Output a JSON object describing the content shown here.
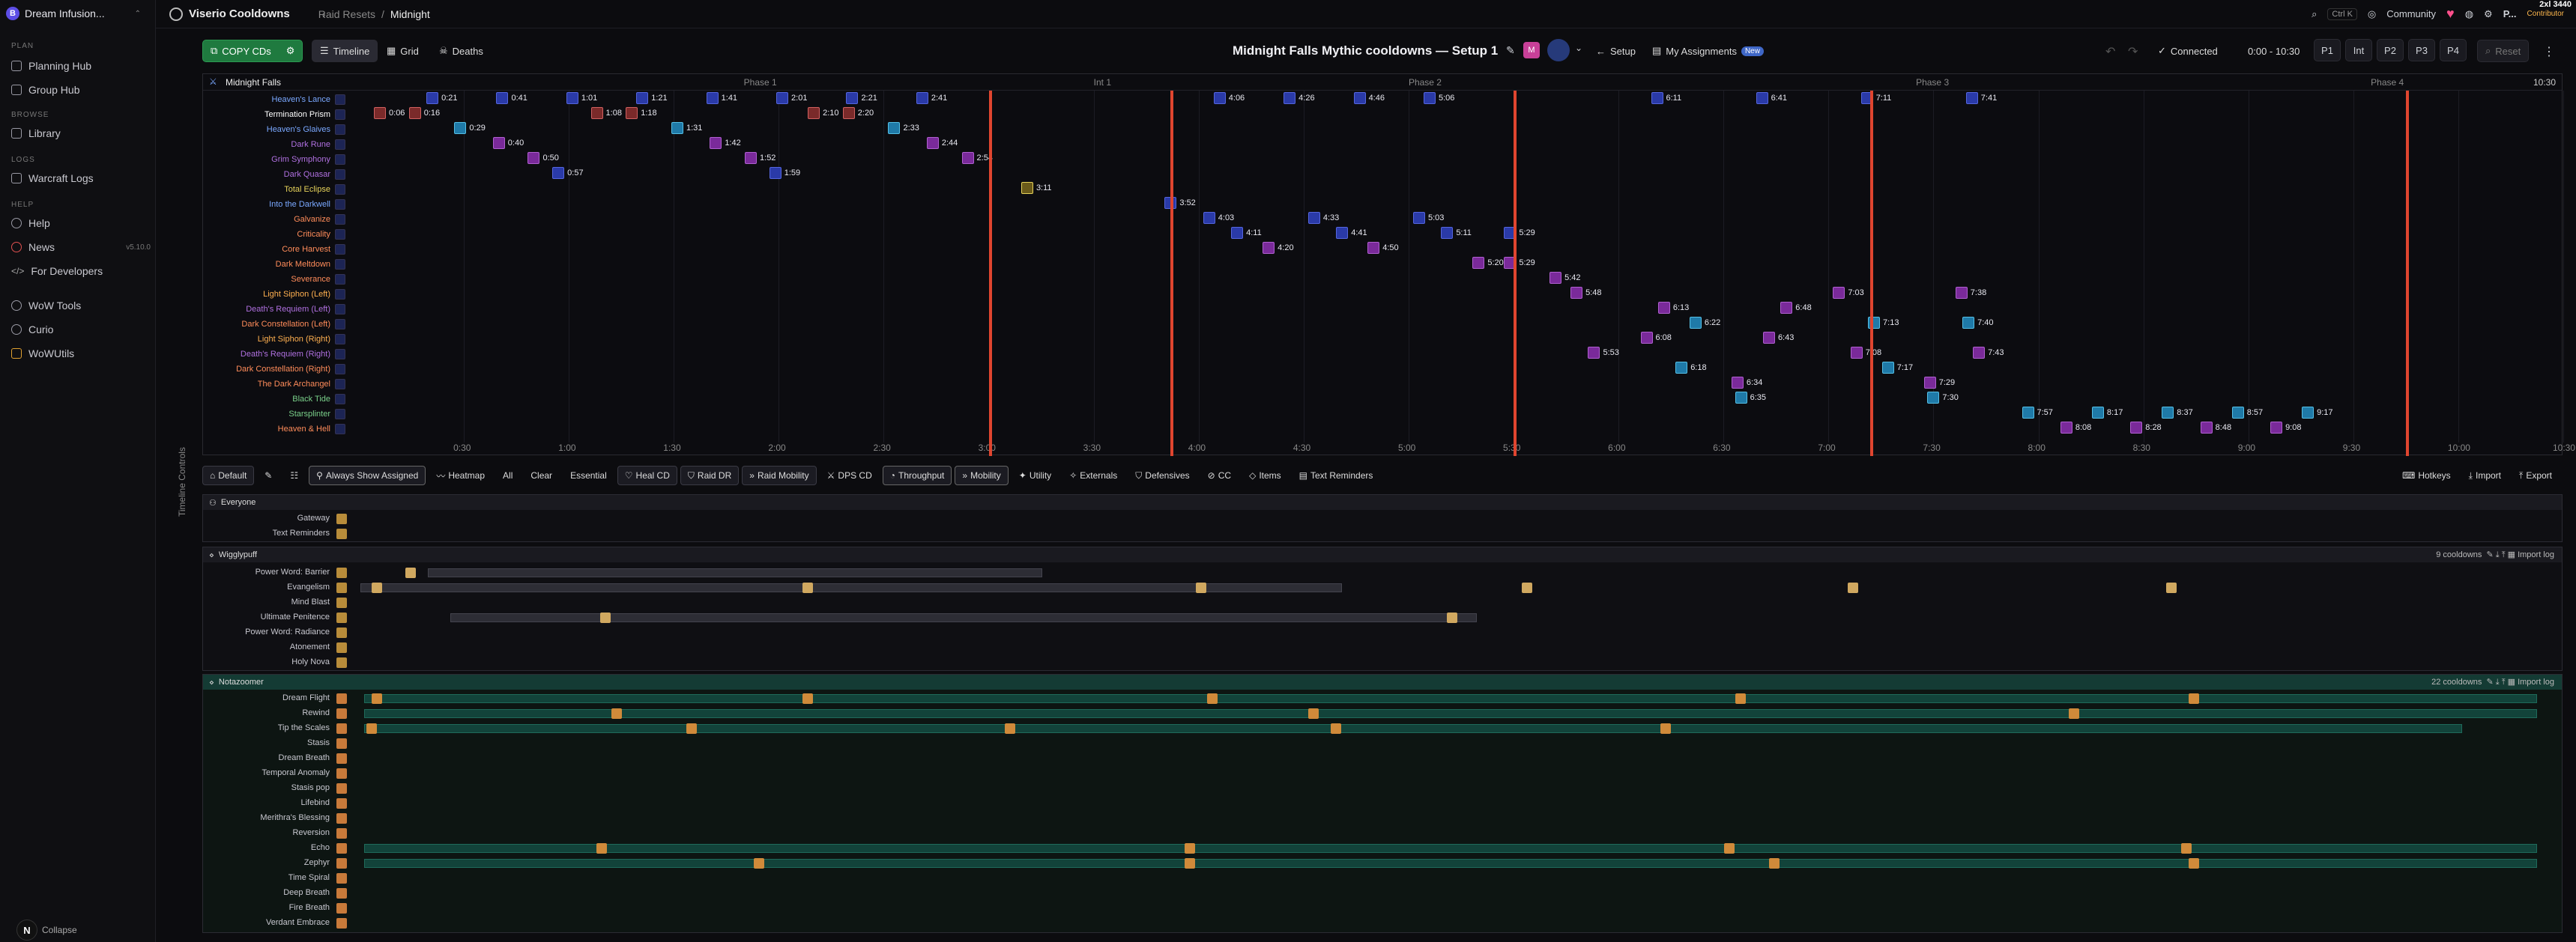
{
  "sidebar": {
    "workspace": "Dream Infusion...",
    "sections": {
      "plan": "PLAN",
      "browse": "BROWSE",
      "logs": "LOGS",
      "help": "HELP"
    },
    "items": {
      "planning": "Planning Hub",
      "group": "Group Hub",
      "library": "Library",
      "warcraft": "Warcraft Logs",
      "help": "Help",
      "news": "News",
      "version": "v5.10.0",
      "devs": "For Developers",
      "tools": "WoW Tools",
      "curio": "Curio",
      "wowutils": "WoWUtils"
    },
    "collapse": "Collapse",
    "avatar": "N"
  },
  "topbar": {
    "brand": "Viserio Cooldowns",
    "crumb1": "Raid Resets",
    "sep": "/",
    "crumb2": "Midnight",
    "search_kbd": "Ctrl K",
    "community": "Community",
    "user": "P...",
    "contrib": "Contributor",
    "dims": "2xl 3440"
  },
  "toolbar": {
    "copy": "COPY CDs",
    "timeline": "Timeline",
    "grid": "Grid",
    "deaths": "Deaths",
    "title": "Midnight Falls Mythic cooldowns — Setup 1",
    "setup": "Setup",
    "assign": "My Assignments",
    "new": "New",
    "connected": "Connected",
    "range": "0:00 - 10:30",
    "p1": "P1",
    "int": "Int",
    "p2": "P2",
    "p3": "P3",
    "p4": "P4",
    "reset": "Reset"
  },
  "timeline": {
    "boss": "Midnight Falls",
    "end": "10:30",
    "phases": [
      "Phase 1",
      "Int 1",
      "Phase 2",
      "Phase 3",
      "Phase 4"
    ],
    "rows": [
      {
        "n": "Heaven's Lance",
        "c": "#7aa8ff"
      },
      {
        "n": "Termination Prism",
        "c": "#ffffff"
      },
      {
        "n": "Heaven's Glaives",
        "c": "#7aa8ff"
      },
      {
        "n": "Dark Rune",
        "c": "#b070e0"
      },
      {
        "n": "Grim Symphony",
        "c": "#b070e0"
      },
      {
        "n": "Dark Quasar",
        "c": "#b070e0"
      },
      {
        "n": "Total Eclipse",
        "c": "#e6d25a"
      },
      {
        "n": "Into the Darkwell",
        "c": "#7aa8ff"
      },
      {
        "n": "Galvanize",
        "c": "#ff8c5a"
      },
      {
        "n": "Criticality",
        "c": "#ff8c5a"
      },
      {
        "n": "Core Harvest",
        "c": "#ff8c5a"
      },
      {
        "n": "Dark Meltdown",
        "c": "#ff8c5a"
      },
      {
        "n": "Severance",
        "c": "#ff8c5a"
      },
      {
        "n": "Light Siphon (Left)",
        "c": "#ffb050"
      },
      {
        "n": "Death's Requiem (Left)",
        "c": "#b070e0"
      },
      {
        "n": "Dark Constellation (Left)",
        "c": "#ff8c5a"
      },
      {
        "n": "Light Siphon (Right)",
        "c": "#ffb050"
      },
      {
        "n": "Death's Requiem (Right)",
        "c": "#b070e0"
      },
      {
        "n": "Dark Constellation (Right)",
        "c": "#ff8c5a"
      },
      {
        "n": "The Dark Archangel",
        "c": "#ff8c5a"
      },
      {
        "n": "Black Tide",
        "c": "#7ad08a"
      },
      {
        "n": "Starsplinter",
        "c": "#7ad08a"
      },
      {
        "n": "Heaven & Hell",
        "c": "#ff8c5a"
      }
    ],
    "axis": [
      "0:30",
      "1:00",
      "1:30",
      "2:00",
      "2:30",
      "3:00",
      "3:30",
      "4:00",
      "4:30",
      "5:00",
      "5:30",
      "6:00",
      "6:30",
      "7:00",
      "7:30",
      "8:00",
      "8:30",
      "9:00",
      "9:30",
      "10:00",
      "10:30"
    ],
    "casts": [
      [
        "0:06",
        "r",
        0,
        1
      ],
      [
        "0:16",
        "r",
        0,
        1
      ],
      [
        "0:21",
        "b",
        0,
        0
      ],
      [
        "0:41",
        "b",
        0,
        0
      ],
      [
        "1:01",
        "b",
        0,
        0
      ],
      [
        "1:21",
        "b",
        0,
        0
      ],
      [
        "1:41",
        "b",
        0,
        0
      ],
      [
        "2:01",
        "b",
        0,
        0
      ],
      [
        "2:21",
        "b",
        0,
        0
      ],
      [
        "2:41",
        "b",
        0,
        0
      ],
      [
        "1:08",
        "r",
        0,
        1
      ],
      [
        "1:18",
        "r",
        0,
        1
      ],
      [
        "2:10",
        "r",
        0,
        1
      ],
      [
        "2:20",
        "r",
        0,
        1
      ],
      [
        "0:29",
        "c",
        0,
        2
      ],
      [
        "1:31",
        "c",
        0,
        2
      ],
      [
        "2:33",
        "c",
        0,
        2
      ],
      [
        "0:40",
        "p",
        0,
        3
      ],
      [
        "1:42",
        "p",
        0,
        3
      ],
      [
        "2:44",
        "p",
        0,
        3
      ],
      [
        "0:50",
        "p",
        0,
        4
      ],
      [
        "1:52",
        "p",
        0,
        4
      ],
      [
        "2:54",
        "p",
        0,
        4
      ],
      [
        "0:57",
        "b",
        0,
        5
      ],
      [
        "1:59",
        "b",
        0,
        5
      ],
      [
        "3:11",
        "y",
        0,
        6
      ],
      [
        "3:52",
        "b",
        0,
        7
      ],
      [
        "4:03",
        "b",
        0,
        8
      ],
      [
        "4:33",
        "b",
        0,
        8
      ],
      [
        "5:03",
        "b",
        0,
        8
      ],
      [
        "4:11",
        "b",
        0,
        9
      ],
      [
        "4:41",
        "b",
        0,
        9
      ],
      [
        "5:11",
        "b",
        0,
        9
      ],
      [
        "4:20",
        "p",
        0,
        10
      ],
      [
        "4:50",
        "p",
        0,
        10
      ],
      [
        "5:20",
        "p",
        0,
        11
      ],
      [
        "5:29",
        "b",
        0,
        9
      ],
      [
        "5:29",
        "p",
        0,
        11
      ],
      [
        "5:42",
        "p",
        0,
        12
      ],
      [
        "4:06",
        "b",
        0,
        0
      ],
      [
        "4:26",
        "b",
        0,
        0
      ],
      [
        "4:46",
        "b",
        0,
        0
      ],
      [
        "5:06",
        "b",
        0,
        0
      ],
      [
        "6:11",
        "b",
        0,
        0
      ],
      [
        "6:41",
        "b",
        0,
        0
      ],
      [
        "7:11",
        "b",
        0,
        0
      ],
      [
        "7:41",
        "b",
        0,
        0
      ],
      [
        "5:48",
        "p",
        0,
        13
      ],
      [
        "7:03",
        "p",
        0,
        13
      ],
      [
        "7:38",
        "p",
        0,
        13
      ],
      [
        "6:13",
        "p",
        0,
        14
      ],
      [
        "6:48",
        "p",
        0,
        14
      ],
      [
        "6:22",
        "c",
        0,
        15
      ],
      [
        "7:13",
        "c",
        0,
        15
      ],
      [
        "7:40",
        "c",
        0,
        15
      ],
      [
        "6:08",
        "p",
        0,
        16
      ],
      [
        "6:43",
        "p",
        0,
        16
      ],
      [
        "5:53",
        "p",
        0,
        17
      ],
      [
        "7:08",
        "p",
        0,
        17
      ],
      [
        "7:43",
        "p",
        0,
        17
      ],
      [
        "6:18",
        "c",
        0,
        18
      ],
      [
        "7:17",
        "c",
        0,
        18
      ],
      [
        "6:34",
        "p",
        0,
        19
      ],
      [
        "7:29",
        "p",
        0,
        19
      ],
      [
        "6:35",
        "c",
        0,
        20
      ],
      [
        "7:30",
        "c",
        0,
        20
      ],
      [
        "7:57",
        "c",
        0,
        21
      ],
      [
        "8:17",
        "c",
        0,
        21
      ],
      [
        "8:37",
        "c",
        0,
        21
      ],
      [
        "8:57",
        "c",
        0,
        21
      ],
      [
        "9:17",
        "c",
        0,
        21
      ],
      [
        "8:08",
        "p",
        0,
        22
      ],
      [
        "8:28",
        "p",
        0,
        22
      ],
      [
        "8:48",
        "p",
        0,
        22
      ],
      [
        "9:08",
        "p",
        0,
        22
      ]
    ]
  },
  "controls": {
    "vert": "Timeline Controls",
    "default": "Default",
    "always": "Always Show Assigned",
    "heatmap": "Heatmap",
    "all": "All",
    "clear": "Clear",
    "essential": "Essential",
    "healcd": "Heal CD",
    "raiddr": "Raid DR",
    "raidmob": "Raid Mobility",
    "dpscd": "DPS CD",
    "throughput": "Throughput",
    "mobility": "Mobility",
    "utility": "Utility",
    "externals": "Externals",
    "defensives": "Defensives",
    "cc": "CC",
    "items": "Items",
    "textrem": "Text Reminders",
    "hotkeys": "Hotkeys",
    "import": "Import",
    "export": "Export"
  },
  "everyone": {
    "title": "Everyone",
    "rows": [
      "Gateway",
      "Text Reminders"
    ]
  },
  "wiggly": {
    "title": "Wigglypuff",
    "count": "9 cooldowns",
    "importlog": "Import log",
    "rows": [
      "Power Word: Barrier",
      "Evangelism",
      "Mind Blast",
      "Ultimate Penitence",
      "Power Word: Radiance",
      "Atonement",
      "Holy Nova"
    ]
  },
  "nota": {
    "title": "Notazoomer",
    "count": "22 cooldowns",
    "importlog": "Import log",
    "rows": [
      "Dream Flight",
      "Rewind",
      "Tip the Scales",
      "Stasis",
      "Dream Breath",
      "Temporal Anomaly",
      "Stasis pop",
      "Lifebind",
      "Merithra's Blessing",
      "Reversion",
      "Echo",
      "Zephyr",
      "Time Spiral",
      "Deep Breath",
      "Fire Breath",
      "Verdant Embrace"
    ]
  }
}
